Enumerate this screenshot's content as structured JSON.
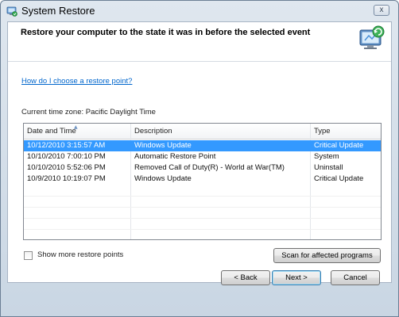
{
  "window": {
    "title": "System Restore",
    "close_label": "x"
  },
  "header": {
    "title": "Restore your computer to the state it was in before the selected event"
  },
  "help_link": "How do I choose a restore point?",
  "timezone_text": "Current time zone: Pacific Daylight Time",
  "restore_list": {
    "columns": [
      "Date and Time",
      "Description",
      "Type"
    ],
    "rows": [
      {
        "date": "10/12/2010 3:15:57 AM",
        "description": "Windows Update",
        "type": "Critical Update",
        "selected": true
      },
      {
        "date": "10/10/2010 7:00:10 PM",
        "description": "Automatic Restore Point",
        "type": "System",
        "selected": false
      },
      {
        "date": "10/10/2010 5:52:06 PM",
        "description": "Removed Call of Duty(R) - World at War(TM)",
        "type": "Uninstall",
        "selected": false
      },
      {
        "date": "10/9/2010 10:19:07 PM",
        "description": "Windows Update",
        "type": "Critical Update",
        "selected": false
      }
    ]
  },
  "show_more": {
    "label": "Show more restore points",
    "checked": false
  },
  "buttons": {
    "scan": "Scan for affected programs",
    "back": "< Back",
    "next": "Next >",
    "cancel": "Cancel"
  },
  "colors": {
    "selection": "#3399ff",
    "link": "#0066cc"
  },
  "icons": {
    "title": "system-restore-icon",
    "header": "restore-monitor-icon"
  }
}
